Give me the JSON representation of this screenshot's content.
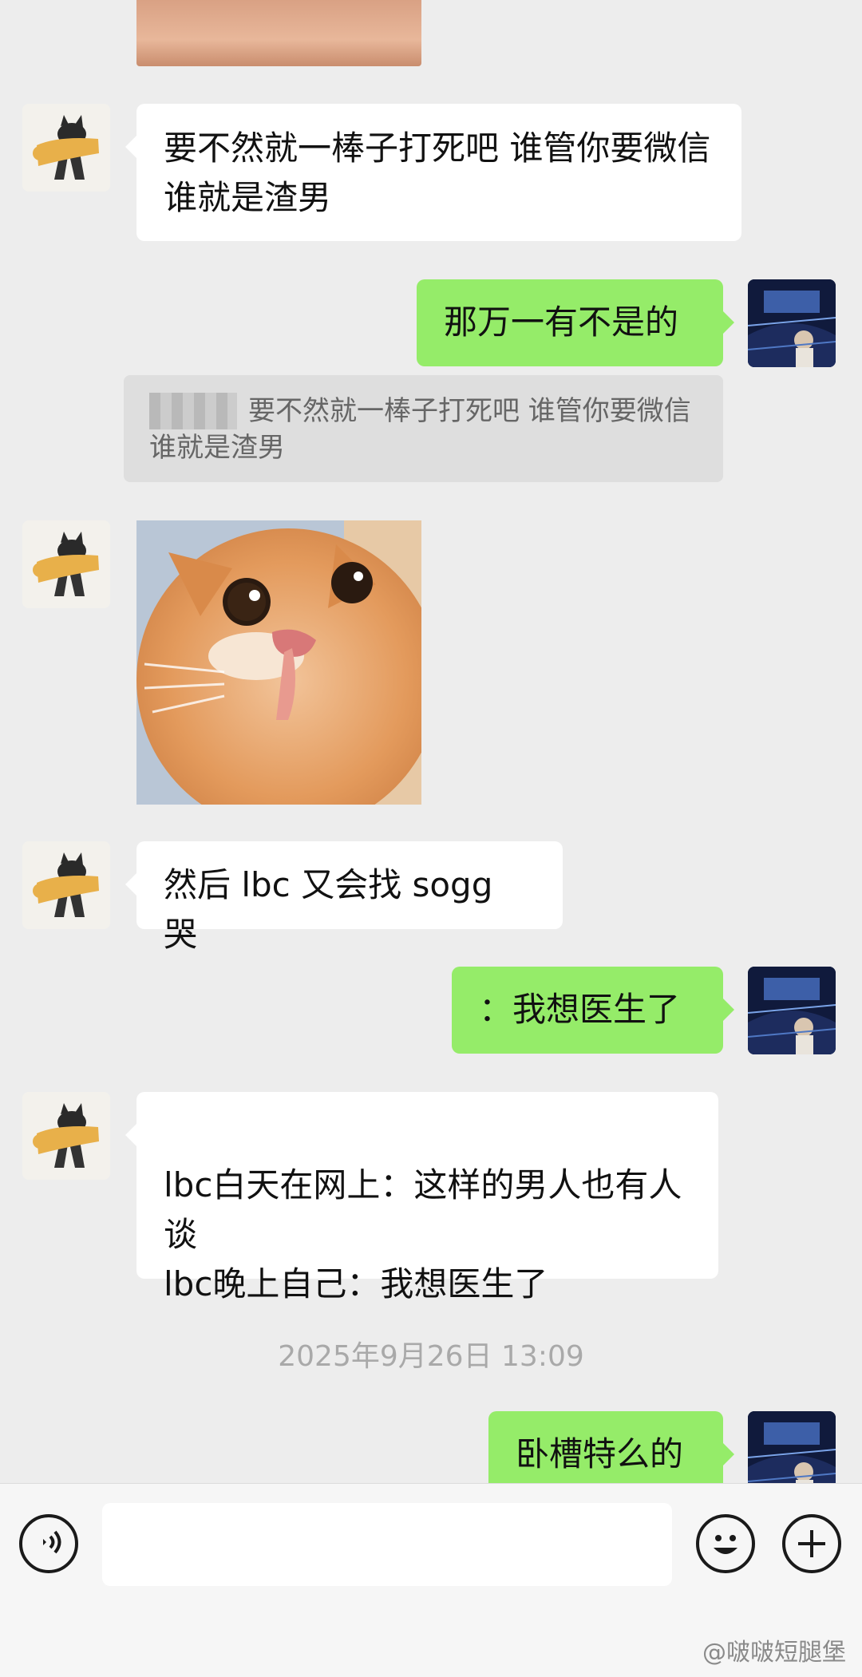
{
  "messages": [
    {
      "side": "left",
      "text": "要不然就一棒子打死吧 谁管你要微信谁就是渣男"
    },
    {
      "side": "right",
      "text": "那万一有不是的",
      "quote": "要不然就一棒子打死吧 谁管你要微信谁就是渣男"
    },
    {
      "side": "left",
      "type": "sticker",
      "icon": "surprised-cat-sticker"
    },
    {
      "side": "left",
      "text": "然后 lbc 又会找 sogg 哭"
    },
    {
      "side": "right",
      "text": "：我想医生了"
    },
    {
      "side": "left",
      "text": "lbc白天在网上：这样的男人也有人谈\nlbc晚上自己：我想医生了"
    },
    {
      "side": "right",
      "text": "卧槽特么的"
    }
  ],
  "timestamp": "2025年9月26日 13:09",
  "input_bar": {
    "voice_icon": "voice-icon",
    "emoji_icon": "emoji-icon",
    "plus_icon": "plus-icon"
  },
  "watermark": "@啵啵短腿堡",
  "colors": {
    "background": "#ededed",
    "my_bubble": "#95ec69",
    "their_bubble": "#ffffff"
  }
}
